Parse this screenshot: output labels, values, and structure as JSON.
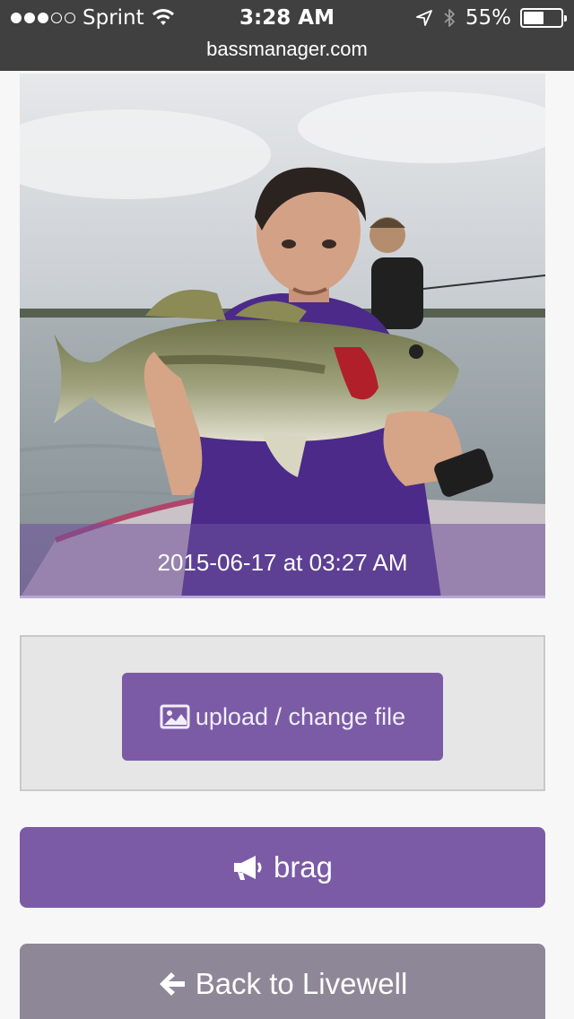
{
  "status_bar": {
    "carrier": "Sprint",
    "signal_bars_filled": 3,
    "signal_bars_total": 5,
    "time": "3:28 AM",
    "battery_percent_label": "55%",
    "battery_level": 0.55
  },
  "browser": {
    "url": "bassmanager.com"
  },
  "catch": {
    "timestamp": "2015-06-17 at 03:27 AM"
  },
  "upload": {
    "button_label": "upload / change file",
    "icon": "image-icon"
  },
  "brag": {
    "button_label": "brag",
    "icon": "megaphone-icon"
  },
  "back": {
    "button_label": "Back to Livewell",
    "icon": "arrow-left-icon"
  },
  "colors": {
    "accent_purple": "#7b5ba6",
    "back_button_gray": "#8e8797",
    "chrome_dark": "#404040"
  }
}
